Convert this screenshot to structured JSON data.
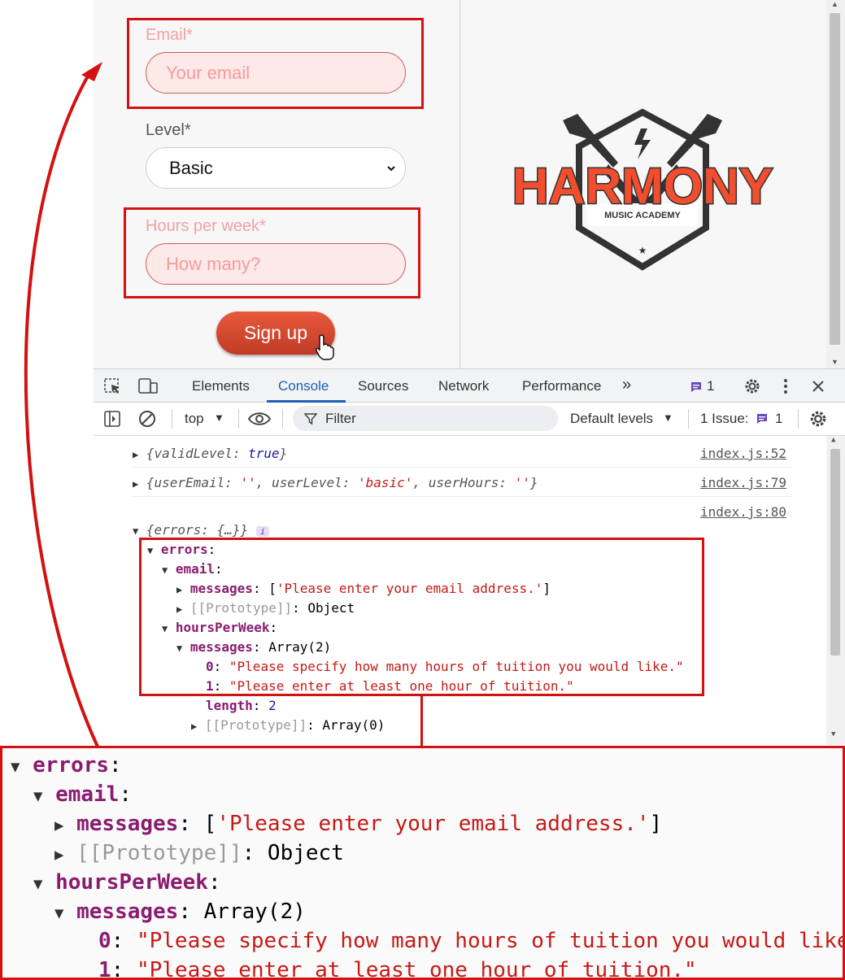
{
  "form": {
    "email_label": "Email*",
    "email_placeholder": "Your email",
    "level_label": "Level*",
    "level_value": "Basic",
    "hours_label": "Hours per week*",
    "hours_placeholder": "How many?",
    "signup_label": "Sign up"
  },
  "logo": {
    "name": "HARMONY",
    "tagline": "MUSIC ACADEMY",
    "colors": {
      "accent": "#f04e2f",
      "dark": "#333333"
    }
  },
  "devtools": {
    "tabs": [
      "Elements",
      "Console",
      "Sources",
      "Network",
      "Performance"
    ],
    "active_tab": "Console",
    "messages_badge": "1",
    "context": "top",
    "filter_placeholder": "Filter",
    "levels": "Default levels",
    "issues_label": "1 Issue:",
    "issues_count": "1"
  },
  "console": {
    "log1": {
      "text_key": "validLevel",
      "text_val": "true",
      "source": "index.js:52"
    },
    "log2": {
      "k1": "userEmail",
      "v1": "''",
      "k2": "userLevel",
      "v2": "'basic'",
      "k3": "userHours",
      "v3": "''",
      "source": "index.js:79"
    },
    "log3": {
      "summary": "{errors: {…}}",
      "info": "i",
      "source": "index.js:80"
    },
    "tree": {
      "errors": "errors",
      "email": "email",
      "messages": "messages",
      "email_message": "'Please enter your email address.'",
      "prototype": "[[Prototype]]",
      "object": "Object",
      "hoursPerWeek": "hoursPerWeek",
      "array2": "Array(2)",
      "idx0": "0",
      "msg0": "\"Please specify how many hours of tuition you would like.\"",
      "idx1": "1",
      "msg1": "\"Please enter at least one hour of tuition.\"",
      "length_key": "length",
      "length_val": "2",
      "array0": "Array(0)"
    }
  }
}
